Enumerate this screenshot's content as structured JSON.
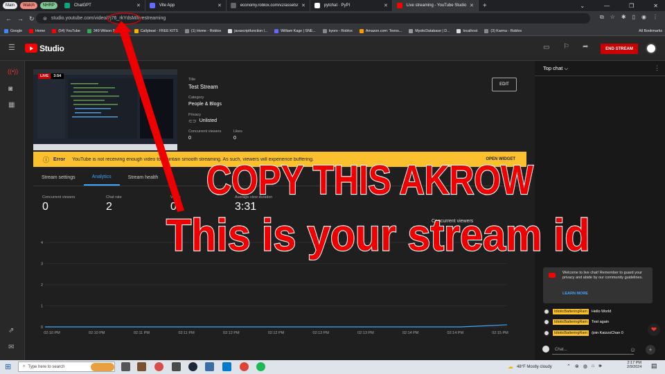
{
  "browser": {
    "tab_groups": [
      {
        "label": "Main",
        "color": "#e8eaed"
      },
      {
        "label": "Watch",
        "color": "#f28b82"
      },
      {
        "label": "NHRP",
        "color": "#81c995"
      }
    ],
    "tabs": [
      {
        "label": "ChatGPT",
        "fav": "#10a37f"
      },
      {
        "label": "Vite App",
        "fav": "#646cff"
      },
      {
        "label": "economy.roblox.com/v2/assets/",
        "fav": "#666666"
      },
      {
        "label": "pytchat · PyPI",
        "fav": "#ffffff"
      },
      {
        "label": "Live streaming - YouTube Studio",
        "fav": "#ff0000"
      }
    ],
    "url": "studio.youtube.com/video/7j76_rkYdsM/livestreaming",
    "bookmarks": [
      {
        "label": "Google",
        "c": "#4285f4"
      },
      {
        "label": "Home",
        "c": "#ff0000"
      },
      {
        "label": "(54) YouTube",
        "c": "#ff0000"
      },
      {
        "label": "349 Wilson St - Go...",
        "c": "#34a853"
      },
      {
        "label": "Callybeat - FREE KITS",
        "c": "#f4b400"
      },
      {
        "label": "(1) Home - Roblox",
        "c": "#888888"
      },
      {
        "label": "javascriptfunction l...",
        "c": "#dddddd"
      },
      {
        "label": "William Kage | SNE...",
        "c": "#6666ff"
      },
      {
        "label": "kyoro - Roblox",
        "c": "#888888"
      },
      {
        "label": "Amazon.com: Teens...",
        "c": "#ff9900"
      },
      {
        "label": "MysticDatabase | D...",
        "c": "#999999"
      },
      {
        "label": "localhost",
        "c": "#dddddd"
      },
      {
        "label": "(3) Karma - Roblox",
        "c": "#888888"
      }
    ],
    "all_bookmarks": "All Bookmarks"
  },
  "studio": {
    "logo_text": "Studio",
    "end_stream": "END STREAM",
    "live_badge": "LIVE",
    "live_time": "3:54",
    "title_label": "Title",
    "title_value": "Test Stream",
    "category_label": "Category",
    "category_value": "People & Blogs",
    "privacy_label": "Privacy",
    "privacy_value": "Unlisted",
    "concurrent_label": "Concurrent viewers",
    "concurrent_value": "0",
    "likes_label": "Likes",
    "likes_value": "0",
    "edit_label": "EDIT",
    "error_title": "Error",
    "error_text": "YouTube is not receiving enough video to maintain smooth streaming. As such, viewers will experience buffering.",
    "open_widget": "OPEN WIDGET",
    "tabs": [
      "Stream settings",
      "Analytics",
      "Stream health"
    ],
    "active_tab": 1,
    "metrics": [
      {
        "label": "Concurrent viewers",
        "value": "0"
      },
      {
        "label": "Chat rate",
        "value": "2"
      },
      {
        "label": "Views",
        "value": "0"
      },
      {
        "label": "Average view duration",
        "value": "3:31"
      }
    ],
    "concurrent_chart_label": "Concurrent viewers"
  },
  "chart_data": {
    "type": "line",
    "title": "",
    "xlabel": "",
    "ylabel": "",
    "x": [
      "02:10 PM",
      "02:10 PM",
      "02:11 PM",
      "02:11 PM",
      "02:12 PM",
      "02:12 PM",
      "02:13 PM",
      "02:13 PM",
      "02:14 PM",
      "02:14 PM",
      "02:15 PM"
    ],
    "yticks": [
      "0",
      "1",
      "2",
      "3",
      "4"
    ],
    "ylim": [
      0,
      4
    ],
    "series": [
      {
        "values": [
          0,
          0,
          0,
          0,
          0,
          0,
          0,
          0,
          0,
          0,
          0.1
        ],
        "color": "#3ea6ff"
      }
    ]
  },
  "chat": {
    "header": "Top chat",
    "welcome": "Welcome to live chat! Remember to guard your privacy and abide by our community guidelines.",
    "learn_more": "LEARN MORE",
    "messages": [
      {
        "name": "IdioticBatteringRam",
        "text": "Hello World"
      },
      {
        "name": "IdioticBatteringRam",
        "text": "Test again"
      },
      {
        "name": "IdioticBatteringRam",
        "text": "/join KaizzoChan 0"
      }
    ],
    "input_placeholder": "Chat..."
  },
  "overlay": {
    "line1": "COPY THIS AKROW",
    "line2": "This is your stream id",
    "color": "#e00000"
  },
  "taskbar": {
    "search_placeholder": "Type here to search",
    "weather": "48°F  Mostly cloudy",
    "time": "2:17 PM",
    "date": "2/9/2024"
  }
}
